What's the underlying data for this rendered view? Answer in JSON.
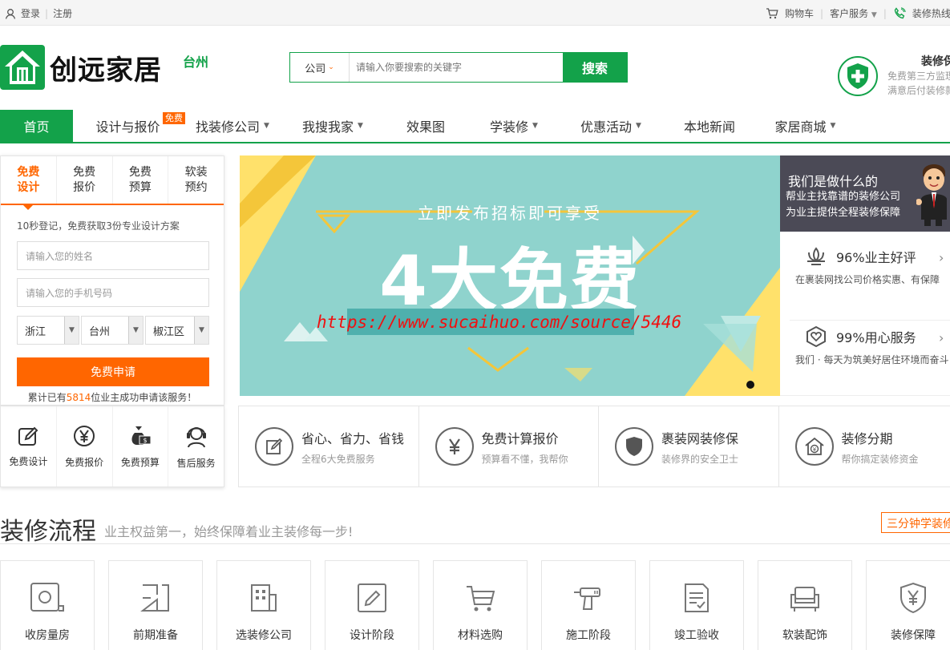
{
  "topbar": {
    "login": "登录",
    "register": "注册",
    "cart": "购物车",
    "service": "客户服务",
    "hotline": "装修热线:"
  },
  "header": {
    "logo_text": "创远家居",
    "city": "台州",
    "search_type": "公司",
    "search_placeholder": "请输入你要搜索的关键字",
    "search_button": "搜索",
    "guard_title": "装修保",
    "guard_line1": "免费第三方监理",
    "guard_line2": "满意后付装修款"
  },
  "nav": [
    {
      "label": "首页",
      "active": true
    },
    {
      "label": "设计与报价",
      "badge": "免费"
    },
    {
      "label": "找装修公司",
      "dropdown": true
    },
    {
      "label": "我搜我家",
      "dropdown": true
    },
    {
      "label": "效果图"
    },
    {
      "label": "学装修",
      "dropdown": true
    },
    {
      "label": "优惠活动",
      "dropdown": true
    },
    {
      "label": "本地新闻"
    },
    {
      "label": "家居商城",
      "dropdown": true
    }
  ],
  "form": {
    "tabs": [
      {
        "l1": "免费",
        "l2": "设计"
      },
      {
        "l1": "免费",
        "l2": "报价"
      },
      {
        "l1": "免费",
        "l2": "预算"
      },
      {
        "l1": "软装",
        "l2": "预约"
      }
    ],
    "note": "10秒登记，免费获取3份专业设计方案",
    "name_placeholder": "请输入您的姓名",
    "phone_placeholder": "请输入您的手机号码",
    "province": "浙江",
    "city": "台州",
    "district": "椒江区",
    "submit": "免费申请",
    "count_pre": "累计已有",
    "count": "5814",
    "count_post": "位业主成功申请该服务！"
  },
  "service_icons": [
    {
      "label": "免费设计",
      "icon": "edit-icon"
    },
    {
      "label": "免费报价",
      "icon": "yen-icon"
    },
    {
      "label": "免费预算",
      "icon": "moneybag-icon"
    },
    {
      "label": "售后服务",
      "icon": "headset-icon"
    }
  ],
  "banner": {
    "subtitle": "立即发布招标即可享受",
    "title": "4大免费",
    "watermark": "https://www.sucaihuo.com/source/5446"
  },
  "right_panel": {
    "title": "我们是做什么的",
    "line1": "帮业主找靠谱的装修公司",
    "line2": "为业主提供全程装修保障",
    "items": [
      {
        "title": "96%业主好评",
        "desc": "在裹装网找公司价格实惠、有保障"
      },
      {
        "title": "99%用心服务",
        "desc": "我们 · 每天为筑美好居住环境而奋斗"
      }
    ]
  },
  "features": [
    {
      "title": "省心、省力、省钱",
      "desc": "全程6大免费服务",
      "icon": "edit-icon"
    },
    {
      "title": "免费计算报价",
      "desc": "预算看不懂，我帮你",
      "icon": "yen-icon"
    },
    {
      "title": "裹装网装修保",
      "desc": "装修界的安全卫士",
      "icon": "shield-icon"
    },
    {
      "title": "装修分期",
      "desc": "帮你搞定装修资金",
      "icon": "house-yen-icon"
    }
  ],
  "process": {
    "title": "装修流程",
    "subtitle": "业主权益第一，始终保障着业主装修每一步!",
    "link": "三分钟学装修",
    "steps": [
      "收房量房",
      "前期准备",
      "选装修公司",
      "设计阶段",
      "材料选购",
      "施工阶段",
      "竣工验收",
      "软装配饰",
      "装修保障"
    ]
  }
}
